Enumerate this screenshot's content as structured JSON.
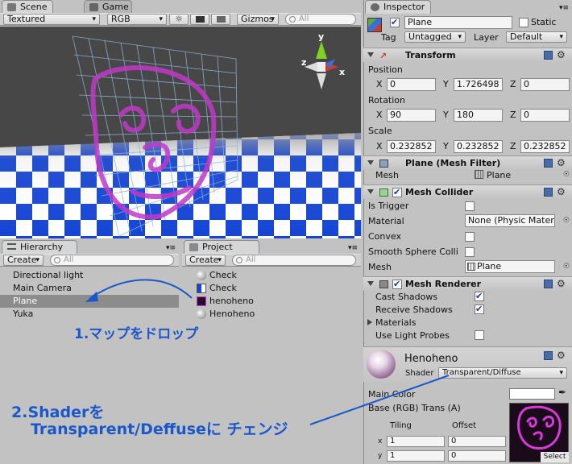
{
  "scene": {
    "tab_scene": "Scene",
    "tab_game": "Game",
    "render_mode": "Textured",
    "color_mode": "RGB",
    "gizmos": "Gizmos",
    "search_placeholder": "All",
    "axis_x": "x",
    "axis_y": "y",
    "axis_z": "z"
  },
  "hierarchy": {
    "tab": "Hierarchy",
    "create": "Create",
    "search_placeholder": "All",
    "items": [
      "Directional light",
      "Main Camera",
      "Plane",
      "Yuka"
    ],
    "selected_index": 2
  },
  "project": {
    "tab": "Project",
    "create": "Create",
    "search_placeholder": "All",
    "items": [
      "Check",
      "Check",
      "henoheno",
      "Henoheno"
    ]
  },
  "inspector": {
    "tab": "Inspector",
    "object_name": "Plane",
    "static_label": "Static",
    "tag_label": "Tag",
    "tag_value": "Untagged",
    "layer_label": "Layer",
    "layer_value": "Default",
    "transform": {
      "title": "Transform",
      "position_label": "Position",
      "rotation_label": "Rotation",
      "scale_label": "Scale",
      "x": "X",
      "y": "Y",
      "z": "Z",
      "position": [
        "0",
        "1.726498",
        "0"
      ],
      "rotation": [
        "90",
        "180",
        "0"
      ],
      "scale": [
        "0.232852",
        "0.232852",
        "0.232852"
      ]
    },
    "mesh_filter": {
      "title": "Plane (Mesh Filter)",
      "mesh_label": "Mesh",
      "mesh_value": "Plane"
    },
    "mesh_collider": {
      "title": "Mesh Collider",
      "is_trigger": "Is Trigger",
      "material": "Material",
      "material_value": "None (Physic Mater",
      "convex": "Convex",
      "smooth": "Smooth Sphere Colli",
      "mesh": "Mesh",
      "mesh_value": "Plane"
    },
    "mesh_renderer": {
      "title": "Mesh Renderer",
      "cast_shadows": "Cast Shadows",
      "receive_shadows": "Receive Shadows",
      "materials": "Materials",
      "use_light_probes": "Use Light Probes"
    },
    "material": {
      "name": "Henoheno",
      "shader_label": "Shader",
      "shader_value": "Transparent/Diffuse",
      "main_color": "Main Color",
      "base_label": "Base (RGB) Trans (A)",
      "tiling": "Tiling",
      "offset": "Offset",
      "x": "x",
      "y": "y",
      "tiling_x": "1",
      "offset_x": "0",
      "tiling_y": "1",
      "offset_y": "0",
      "select": "Select"
    }
  },
  "annotations": {
    "step1": "1.マップをドロップ",
    "step2_line1": "2.Shaderを",
    "step2_line2": "Transparent/Deffuseに チェンジ"
  },
  "colors": {
    "accent": "#1a57c9",
    "selection": "#8c8c8c",
    "scene_bg": "#474747",
    "checker_blue": "#1545d6"
  }
}
